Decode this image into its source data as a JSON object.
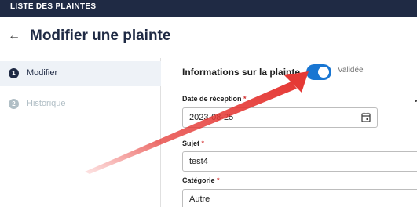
{
  "topbar": {
    "title": "LISTE DES PLAINTES"
  },
  "header": {
    "back_icon": "arrow-left-icon",
    "title": "Modifier une plainte"
  },
  "steps": [
    {
      "number": "1",
      "label": "Modifier",
      "active": true
    },
    {
      "number": "2",
      "label": "Historique",
      "active": false
    }
  ],
  "form": {
    "section_title": "Informations sur la plainte",
    "status_toggle": {
      "on": true,
      "label": "Validée"
    },
    "fields": {
      "reception_date": {
        "label": "Date de réception",
        "required_mark": "*",
        "value": "2023-08-25",
        "icon": "calendar-icon"
      },
      "subject": {
        "label": "Sujet",
        "required_mark": "*",
        "value": "test4"
      },
      "category": {
        "label": "Catégorie",
        "required_mark": "*",
        "value": "Autre"
      }
    }
  },
  "colors": {
    "navy": "#1f2a44",
    "toggle_on": "#1976d2",
    "required": "#d32f2f",
    "annotation_arrow": "#e53935"
  }
}
